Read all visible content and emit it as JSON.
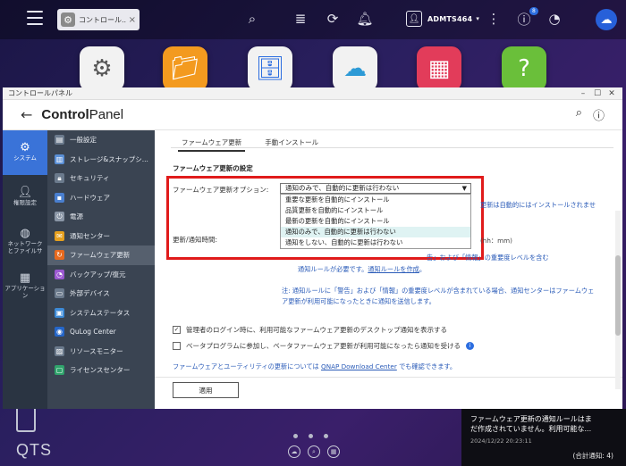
{
  "topbar": {
    "app_tab_label": "コントロール...",
    "username": "ADMTS464",
    "notification_badge": "8"
  },
  "dock": {
    "apps": [
      {
        "name": "control-panel",
        "color": "#f2f2f2"
      },
      {
        "name": "file-station",
        "color": "#f39a1f"
      },
      {
        "name": "storage-snapshots",
        "color": "#f2f2f2"
      },
      {
        "name": "myqnapcloud",
        "color": "#f2f2f2"
      },
      {
        "name": "app-center",
        "color": "#e23c5a"
      },
      {
        "name": "help-center",
        "color": "#6abf3a"
      }
    ]
  },
  "window": {
    "title": "コントロールパネル",
    "header_title_bold": "Control",
    "header_title_rest": "Panel"
  },
  "rail": [
    {
      "label": "システム",
      "icon": "gear-icon"
    },
    {
      "label": "権限設定",
      "icon": "user-icon"
    },
    {
      "label": "ネットワーク\nとファイルサ",
      "icon": "globe-icon"
    },
    {
      "label": "アプリケーション",
      "icon": "apps-icon"
    }
  ],
  "submenu": [
    {
      "label": "一般設定",
      "color": "#6b7a8c"
    },
    {
      "label": "ストレージ&スナップシ...",
      "color": "#5a8fd6"
    },
    {
      "label": "セキュリティ",
      "color": "#6b7a8c"
    },
    {
      "label": "ハードウェア",
      "color": "#4a7fcf"
    },
    {
      "label": "電源",
      "color": "#8a96a6"
    },
    {
      "label": "通知センター",
      "color": "#e6a01e"
    },
    {
      "label": "ファームウェア更新",
      "color": "#e86a1f"
    },
    {
      "label": "バックアップ/復元",
      "color": "#9b59d0"
    },
    {
      "label": "外部デバイス",
      "color": "#6b7a8c"
    },
    {
      "label": "システムステータス",
      "color": "#3d8ad6"
    },
    {
      "label": "QuLog Center",
      "color": "#2566c8"
    },
    {
      "label": "リソースモニター",
      "color": "#6b7a8c"
    },
    {
      "label": "ライセンスセンター",
      "color": "#2fa36b"
    }
  ],
  "content": {
    "tabs": [
      "ファームウェア更新",
      "手動インストール"
    ],
    "section_title": "ファームウェア更新の設定",
    "option_label": "ファームウェア更新オプション:",
    "selected_option": "通知のみで、自動的に更新は行わない",
    "dropdown_options": [
      "重要な更新を自動的にインストール",
      "品質更新を自動的にインストール",
      "最新の更新を自動的にインストール",
      "通知のみで、自動的に更新は行わない",
      "通知をしない、自動的に更新は行わない"
    ],
    "right_note": "更新は自動的にはインストールされませ",
    "update_label": "更新/通知時間:",
    "time_hint": "(hh：mm)",
    "desc_line1": "告」および「情報」の重要度レベルを含む",
    "desc_line2_pre": "通知ルールが必要です。",
    "desc_line2_link": "通知ルールを作成",
    "desc_line2_post": "。",
    "note": "注: 通知ルールに「警告」および「情報」の重要度レベルが含まれている場合、通知センターはファームウェア更新が利用可能になったときに通知を送信します。",
    "checkbox1": "管理者のログイン時に、利用可能なファームウェア更新のデスクトップ通知を表示する",
    "checkbox2": "ベータプログラムに参加し、ベータファームウェア更新が利用可能になったら通知を受ける",
    "footer_pre": "ファームウェアとユーティリティの更新については ",
    "footer_link": "QNAP Download Center",
    "footer_post": " でも確認できます。",
    "apply": "適用"
  },
  "bottom": {
    "logo": "QTS",
    "toast_line1": "ファームウェア更新の通知ルールはま",
    "toast_line2": "だ作成されていません。利用可能な...",
    "toast_time": "2024/12/22 20:23:11",
    "toast_total": "(合計通知: 4)",
    "clock": "23"
  }
}
